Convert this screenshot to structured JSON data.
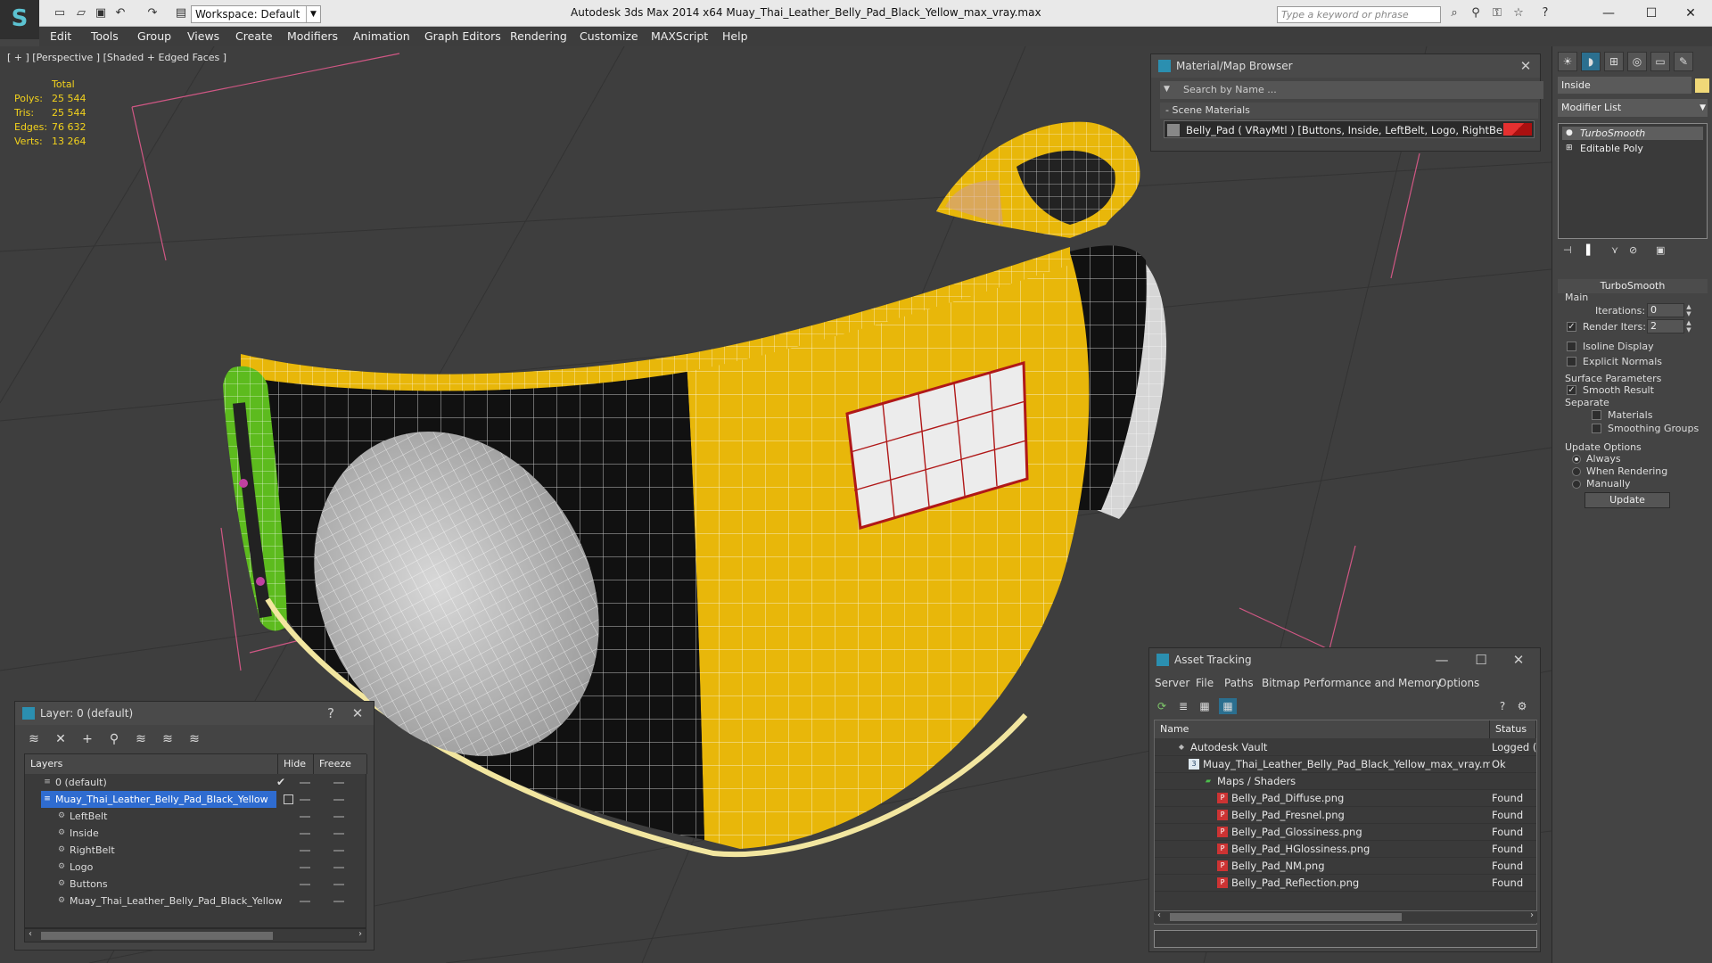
{
  "titlebar": {
    "workspace": "Workspace: Default",
    "window_title": "Autodesk 3ds Max  2014 x64      Muay_Thai_Leather_Belly_Pad_Black_Yellow_max_vray.max",
    "search_placeholder": "Type a keyword or phrase"
  },
  "menu": [
    "Edit",
    "Tools",
    "Group",
    "Views",
    "Create",
    "Modifiers",
    "Animation",
    "Graph Editors",
    "Rendering",
    "Customize",
    "MAXScript",
    "Help"
  ],
  "viewport": {
    "label": "[ + ] [Perspective ] [Shaded + Edged Faces ]",
    "stats": {
      "header": "Total",
      "rows": [
        {
          "label": "Polys:",
          "value": "25 544"
        },
        {
          "label": "Tris:",
          "value": "25 544"
        },
        {
          "label": "Edges:",
          "value": "76 632"
        },
        {
          "label": "Verts:",
          "value": "13 264"
        }
      ]
    }
  },
  "material_browser": {
    "title": "Material/Map Browser",
    "search_placeholder": "Search by Name ...",
    "group": "- Scene Materials",
    "material": "Belly_Pad  ( VRayMtl ) [Buttons, Inside, LeftBelt, Logo, RightBelt]"
  },
  "command_panel": {
    "object_name": "Inside",
    "object_color": "#f0d878",
    "modifier_list": "Modifier List",
    "stack": [
      "TurboSmooth",
      "Editable Poly"
    ],
    "rollout": "TurboSmooth",
    "main_label": "Main",
    "iterations_label": "Iterations:",
    "iterations_value": "0",
    "render_iters_label": "Render Iters:",
    "render_iters_value": "2",
    "isoline": "Isoline Display",
    "explicit_normals": "Explicit Normals",
    "surface_params": "Surface Parameters",
    "smooth_result": "Smooth Result",
    "separate": "Separate",
    "materials": "Materials",
    "smoothing_groups": "Smoothing Groups",
    "update_options": "Update Options",
    "always": "Always",
    "when_rendering": "When Rendering",
    "manually": "Manually",
    "update_button": "Update"
  },
  "layer_panel": {
    "title": "Layer: 0 (default)",
    "help": "?",
    "col_layers": "Layers",
    "col_hide": "Hide",
    "col_freeze": "Freeze",
    "rows": [
      {
        "name": "0 (default)"
      },
      {
        "name": "Muay_Thai_Leather_Belly_Pad_Black_Yellow"
      },
      {
        "name": "LeftBelt"
      },
      {
        "name": "Inside"
      },
      {
        "name": "RightBelt"
      },
      {
        "name": "Logo"
      },
      {
        "name": "Buttons"
      },
      {
        "name": "Muay_Thai_Leather_Belly_Pad_Black_Yellow"
      }
    ]
  },
  "asset_tracking": {
    "title": "Asset Tracking",
    "menu": [
      "Server",
      "File",
      "Paths",
      "Bitmap Performance and Memory",
      "Options"
    ],
    "col_name": "Name",
    "col_status": "Status",
    "rows": [
      {
        "name": "Autodesk Vault",
        "status": "Logged (",
        "icon": "vault-icon"
      },
      {
        "name": "Muay_Thai_Leather_Belly_Pad_Black_Yellow_max_vray.max",
        "status": "Ok",
        "icon": "max-file-icon"
      },
      {
        "name": "Maps / Shaders",
        "status": "",
        "icon": "maps-icon"
      },
      {
        "name": "Belly_Pad_Diffuse.png",
        "status": "Found",
        "icon": "png-icon"
      },
      {
        "name": "Belly_Pad_Fresnel.png",
        "status": "Found",
        "icon": "png-icon"
      },
      {
        "name": "Belly_Pad_Glossiness.png",
        "status": "Found",
        "icon": "png-icon"
      },
      {
        "name": "Belly_Pad_HGlossiness.png",
        "status": "Found",
        "icon": "png-icon"
      },
      {
        "name": "Belly_Pad_NM.png",
        "status": "Found",
        "icon": "png-icon"
      },
      {
        "name": "Belly_Pad_Reflection.png",
        "status": "Found",
        "icon": "png-icon"
      }
    ]
  },
  "colors": {
    "pad_yellow": "#e8b70a",
    "pad_black": "#111111",
    "accent_blue": "#2b8fb0",
    "stats_yellow": "#f3d21c",
    "material_swatch": "#e53030"
  }
}
